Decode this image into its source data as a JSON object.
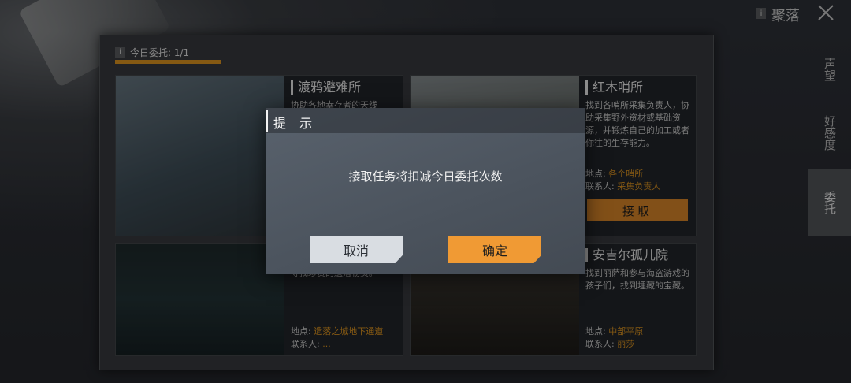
{
  "window": {
    "title": "聚落",
    "info_glyph": "i",
    "close_icon": "close-icon"
  },
  "daily": {
    "info_glyph": "i",
    "label": "今日委托: 1/1",
    "progress": 1.0,
    "bar_color": "#e69a22"
  },
  "tabs": [
    {
      "label": "声望",
      "active": false
    },
    {
      "label": "好感度",
      "active": false
    },
    {
      "label": "委托",
      "active": true
    }
  ],
  "cards": [
    {
      "name": "渡鸦避难所",
      "desc": "协助各地幸存者的天线",
      "location_label": "",
      "location": "",
      "contact_label": "",
      "contact": ""
    },
    {
      "name": "红木哨所",
      "desc": "找到各哨所采集负责人，协助采集野外资材或基础资源，并锻炼自己的加工或者你往的生存能力。",
      "location_label": "地点:",
      "location": "各个哨所",
      "contact_label": "联系人:",
      "contact": "采集负责人",
      "accept_label": "接取"
    },
    {
      "name": "...",
      "desc": "寻找珍贵的遗落物资。",
      "location_label": "地点:",
      "location": "遗落之城地下通道",
      "contact_label": "联系人:",
      "contact": "..."
    },
    {
      "name": "安吉尔孤儿院",
      "desc": "找到丽萨和参与海盗游戏的孩子们，找到埋藏的宝藏。",
      "location_label": "地点:",
      "location": "中部平原",
      "contact_label": "联系人:",
      "contact": "丽莎"
    }
  ],
  "dialog": {
    "title": "提 示",
    "message": "接取任务将扣减今日委托次数",
    "cancel_label": "取消",
    "confirm_label": "确定"
  },
  "colors": {
    "accent": "#f09a34",
    "cancel_bg": "#d9dde2",
    "dialog_bg": "#525a64"
  }
}
